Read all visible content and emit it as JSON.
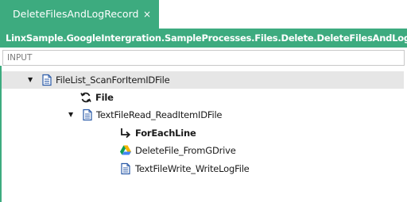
{
  "tab": {
    "title": "DeleteFilesAndLogRecord",
    "close_glyph": "×"
  },
  "path": "LinxSample.GoogleIntergration.SampleProcesses.Files.Delete.DeleteFilesAndLogRecord",
  "input_label": "INPUT",
  "tree": {
    "node1": {
      "label": "FileList_ScanForItemIDFile",
      "icon": "document-icon",
      "expanded": true
    },
    "node2": {
      "label": "File",
      "icon": "loop-icon"
    },
    "node3": {
      "label": "TextFileRead_ReadItemIDFile",
      "icon": "document-icon",
      "expanded": true
    },
    "node4": {
      "label": "ForEachLine",
      "icon": "return-arrow-icon"
    },
    "node5": {
      "label": "DeleteFile_FromGDrive",
      "icon": "google-drive-icon"
    },
    "node6": {
      "label": "TextFileWrite_WriteLogFile",
      "icon": "document-icon"
    }
  },
  "colors": {
    "accent": "#3dab7f",
    "selection": "#e6e6e6",
    "icon_blue": "#2a5aa8"
  }
}
